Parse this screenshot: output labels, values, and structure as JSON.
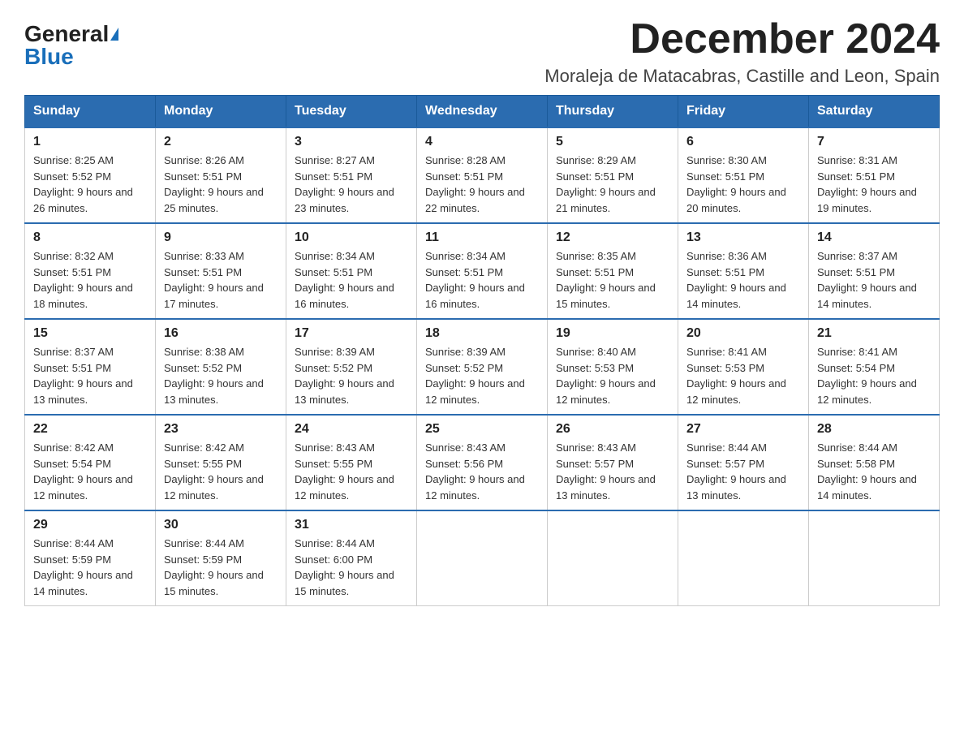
{
  "logo": {
    "general": "General",
    "blue": "Blue"
  },
  "header": {
    "month_year": "December 2024",
    "location": "Moraleja de Matacabras, Castille and Leon, Spain"
  },
  "days_of_week": [
    "Sunday",
    "Monday",
    "Tuesday",
    "Wednesday",
    "Thursday",
    "Friday",
    "Saturday"
  ],
  "weeks": [
    [
      {
        "day": "1",
        "sunrise": "8:25 AM",
        "sunset": "5:52 PM",
        "daylight": "9 hours and 26 minutes."
      },
      {
        "day": "2",
        "sunrise": "8:26 AM",
        "sunset": "5:51 PM",
        "daylight": "9 hours and 25 minutes."
      },
      {
        "day": "3",
        "sunrise": "8:27 AM",
        "sunset": "5:51 PM",
        "daylight": "9 hours and 23 minutes."
      },
      {
        "day": "4",
        "sunrise": "8:28 AM",
        "sunset": "5:51 PM",
        "daylight": "9 hours and 22 minutes."
      },
      {
        "day": "5",
        "sunrise": "8:29 AM",
        "sunset": "5:51 PM",
        "daylight": "9 hours and 21 minutes."
      },
      {
        "day": "6",
        "sunrise": "8:30 AM",
        "sunset": "5:51 PM",
        "daylight": "9 hours and 20 minutes."
      },
      {
        "day": "7",
        "sunrise": "8:31 AM",
        "sunset": "5:51 PM",
        "daylight": "9 hours and 19 minutes."
      }
    ],
    [
      {
        "day": "8",
        "sunrise": "8:32 AM",
        "sunset": "5:51 PM",
        "daylight": "9 hours and 18 minutes."
      },
      {
        "day": "9",
        "sunrise": "8:33 AM",
        "sunset": "5:51 PM",
        "daylight": "9 hours and 17 minutes."
      },
      {
        "day": "10",
        "sunrise": "8:34 AM",
        "sunset": "5:51 PM",
        "daylight": "9 hours and 16 minutes."
      },
      {
        "day": "11",
        "sunrise": "8:34 AM",
        "sunset": "5:51 PM",
        "daylight": "9 hours and 16 minutes."
      },
      {
        "day": "12",
        "sunrise": "8:35 AM",
        "sunset": "5:51 PM",
        "daylight": "9 hours and 15 minutes."
      },
      {
        "day": "13",
        "sunrise": "8:36 AM",
        "sunset": "5:51 PM",
        "daylight": "9 hours and 14 minutes."
      },
      {
        "day": "14",
        "sunrise": "8:37 AM",
        "sunset": "5:51 PM",
        "daylight": "9 hours and 14 minutes."
      }
    ],
    [
      {
        "day": "15",
        "sunrise": "8:37 AM",
        "sunset": "5:51 PM",
        "daylight": "9 hours and 13 minutes."
      },
      {
        "day": "16",
        "sunrise": "8:38 AM",
        "sunset": "5:52 PM",
        "daylight": "9 hours and 13 minutes."
      },
      {
        "day": "17",
        "sunrise": "8:39 AM",
        "sunset": "5:52 PM",
        "daylight": "9 hours and 13 minutes."
      },
      {
        "day": "18",
        "sunrise": "8:39 AM",
        "sunset": "5:52 PM",
        "daylight": "9 hours and 12 minutes."
      },
      {
        "day": "19",
        "sunrise": "8:40 AM",
        "sunset": "5:53 PM",
        "daylight": "9 hours and 12 minutes."
      },
      {
        "day": "20",
        "sunrise": "8:41 AM",
        "sunset": "5:53 PM",
        "daylight": "9 hours and 12 minutes."
      },
      {
        "day": "21",
        "sunrise": "8:41 AM",
        "sunset": "5:54 PM",
        "daylight": "9 hours and 12 minutes."
      }
    ],
    [
      {
        "day": "22",
        "sunrise": "8:42 AM",
        "sunset": "5:54 PM",
        "daylight": "9 hours and 12 minutes."
      },
      {
        "day": "23",
        "sunrise": "8:42 AM",
        "sunset": "5:55 PM",
        "daylight": "9 hours and 12 minutes."
      },
      {
        "day": "24",
        "sunrise": "8:43 AM",
        "sunset": "5:55 PM",
        "daylight": "9 hours and 12 minutes."
      },
      {
        "day": "25",
        "sunrise": "8:43 AM",
        "sunset": "5:56 PM",
        "daylight": "9 hours and 12 minutes."
      },
      {
        "day": "26",
        "sunrise": "8:43 AM",
        "sunset": "5:57 PM",
        "daylight": "9 hours and 13 minutes."
      },
      {
        "day": "27",
        "sunrise": "8:44 AM",
        "sunset": "5:57 PM",
        "daylight": "9 hours and 13 minutes."
      },
      {
        "day": "28",
        "sunrise": "8:44 AM",
        "sunset": "5:58 PM",
        "daylight": "9 hours and 14 minutes."
      }
    ],
    [
      {
        "day": "29",
        "sunrise": "8:44 AM",
        "sunset": "5:59 PM",
        "daylight": "9 hours and 14 minutes."
      },
      {
        "day": "30",
        "sunrise": "8:44 AM",
        "sunset": "5:59 PM",
        "daylight": "9 hours and 15 minutes."
      },
      {
        "day": "31",
        "sunrise": "8:44 AM",
        "sunset": "6:00 PM",
        "daylight": "9 hours and 15 minutes."
      },
      null,
      null,
      null,
      null
    ]
  ]
}
